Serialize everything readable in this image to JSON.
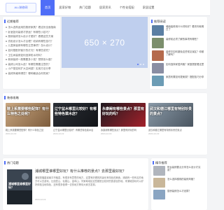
{
  "site": {
    "logo": "ALL装修网"
  },
  "nav": [
    "首页",
    "居家好物",
    "热门话题",
    "居家资讯",
    "个性化搭配",
    "家居设置"
  ],
  "latest": {
    "title": "近期推荐",
    "items": [
      "怎么选购适用的厨房家具？看这份全面指南",
      "卧室如何装修才舒适？有哪些小技巧？",
      "厨房装修怎么设计才更好？看看这些方案",
      "衣柜设计怎么才合理？收纳有哪些技巧？",
      "儿童房装修有哪些注意事项？怎么设计？",
      "如何搭配好客厅的灯光？有哪些讲究？",
      "卫生间装修如何选择防水材料？",
      "新房装修一般需要多少钱？预算怎么做？",
      "装修公司怎么选？有哪些需要注意的？",
      "小户型如何扩大空间感？实用方法分享",
      "装修风格有哪些？哪种最适合你的家？"
    ]
  },
  "banner": {
    "text": "650 × 270"
  },
  "side": {
    "title": "推荐阅读",
    "items": [
      "墙面装修用什么材料好？看完你就明白了",
      "装修前必须了解的事项有哪些？",
      "装修中如何避免这些常见误区？你都了解吗？",
      "如何选择家居风格？家庭搭配看这里",
      "家居布置如何更美观？搭配技巧分享"
    ]
  },
  "rec": {
    "title": "装修攻略",
    "items": [
      {
        "title": "鞋上系需要哪些配饰？有什么特色之处呢？",
        "desc": "鞋上系需要哪些配饰？有什么特色之处",
        "date": "2024-12-19"
      },
      {
        "title": "辽宁盆木哪里比较好？有哪些特色菜木店？",
        "desc": "辽宁盆木哪里比较好？有哪些特色菜木店",
        "date": "2024-12-19"
      },
      {
        "title": "永康阙有哪些景点？那里有好玩的吗？",
        "desc": "永康阙有哪些景点？那里有好玩的吗",
        "date": "2024-12-19"
      },
      {
        "title": "武汉和德江哪里有特别珍贵的景点？",
        "desc": "武汉和德江哪里有特别珍贵的景点",
        "date": "2024-12-19"
      }
    ]
  },
  "hot": {
    "title": "热门话题",
    "image_title": "浦城哪里谁哪里好玩？",
    "head": "浦城哪里谁哪里好玩？有什么推荐的景点？去那里最好玩？",
    "text": "浦城是福建省南平市辖县，有很多有意思的地方，这里有好看的风景也有特色的美食。浦城有一些有名的地方可以去游玩，比如匡山、仙楼山、金鸡山、刘家坳地区这些都是比较好的旅游目的地。来浦城游玩可以好好体验当地特色，还有很多值得一去的地方等待大家去发现。",
    "date": "2024-12-19"
  },
  "tags": {
    "title": "精华推荐",
    "items": [
      "阳台装修要点分享怎么设计才实用？",
      "怎么选择楼梯的装修风格？",
      "厨房装修怎么才划算？"
    ]
  },
  "colors": {
    "accent": "#4f6ef7"
  }
}
